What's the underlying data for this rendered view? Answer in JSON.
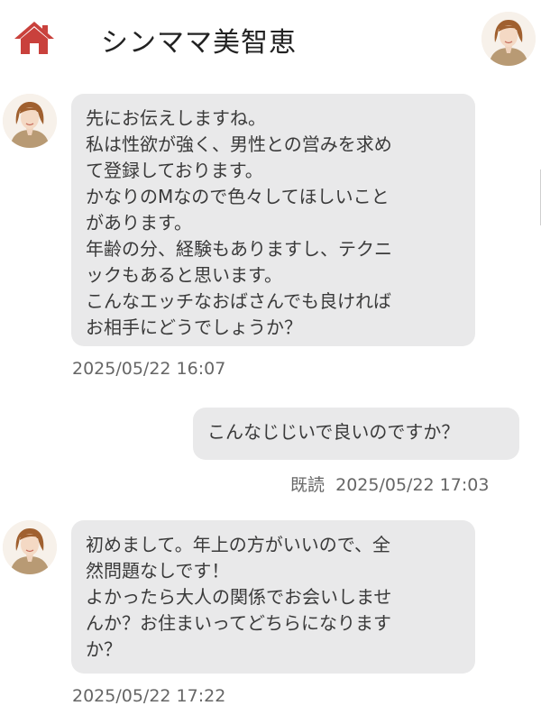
{
  "header": {
    "title": "シンママ美智恵",
    "home_icon": "home-icon",
    "accent_color": "#c9413c"
  },
  "messages": [
    {
      "sender": "partner",
      "lines": [
        "先にお伝えしますね。",
        "私は性欲が強く、男性との営みを求め",
        "て登録しております。",
        "かなりのMなので色々してほしいこと",
        "があります。",
        "年齢の分、経験もありますし、テクニ",
        "ックもあると思います。",
        "こんなエッチなおばさんでも良ければ",
        "お相手にどうでしょうか？"
      ],
      "timestamp": "2025/05/22 16:07"
    },
    {
      "sender": "self",
      "lines": [
        "こんなじじいで良いのですか？"
      ],
      "read_label": "既読",
      "timestamp": "2025/05/22 17:03"
    },
    {
      "sender": "partner",
      "lines": [
        "初めまして。年上の方がいいので、全",
        "然問題なしです！",
        "よかったら大人の関係でお会いしませ",
        "んか？お住まいってどちらになります",
        "か？"
      ],
      "timestamp": "2025/05/22 17:22"
    }
  ]
}
